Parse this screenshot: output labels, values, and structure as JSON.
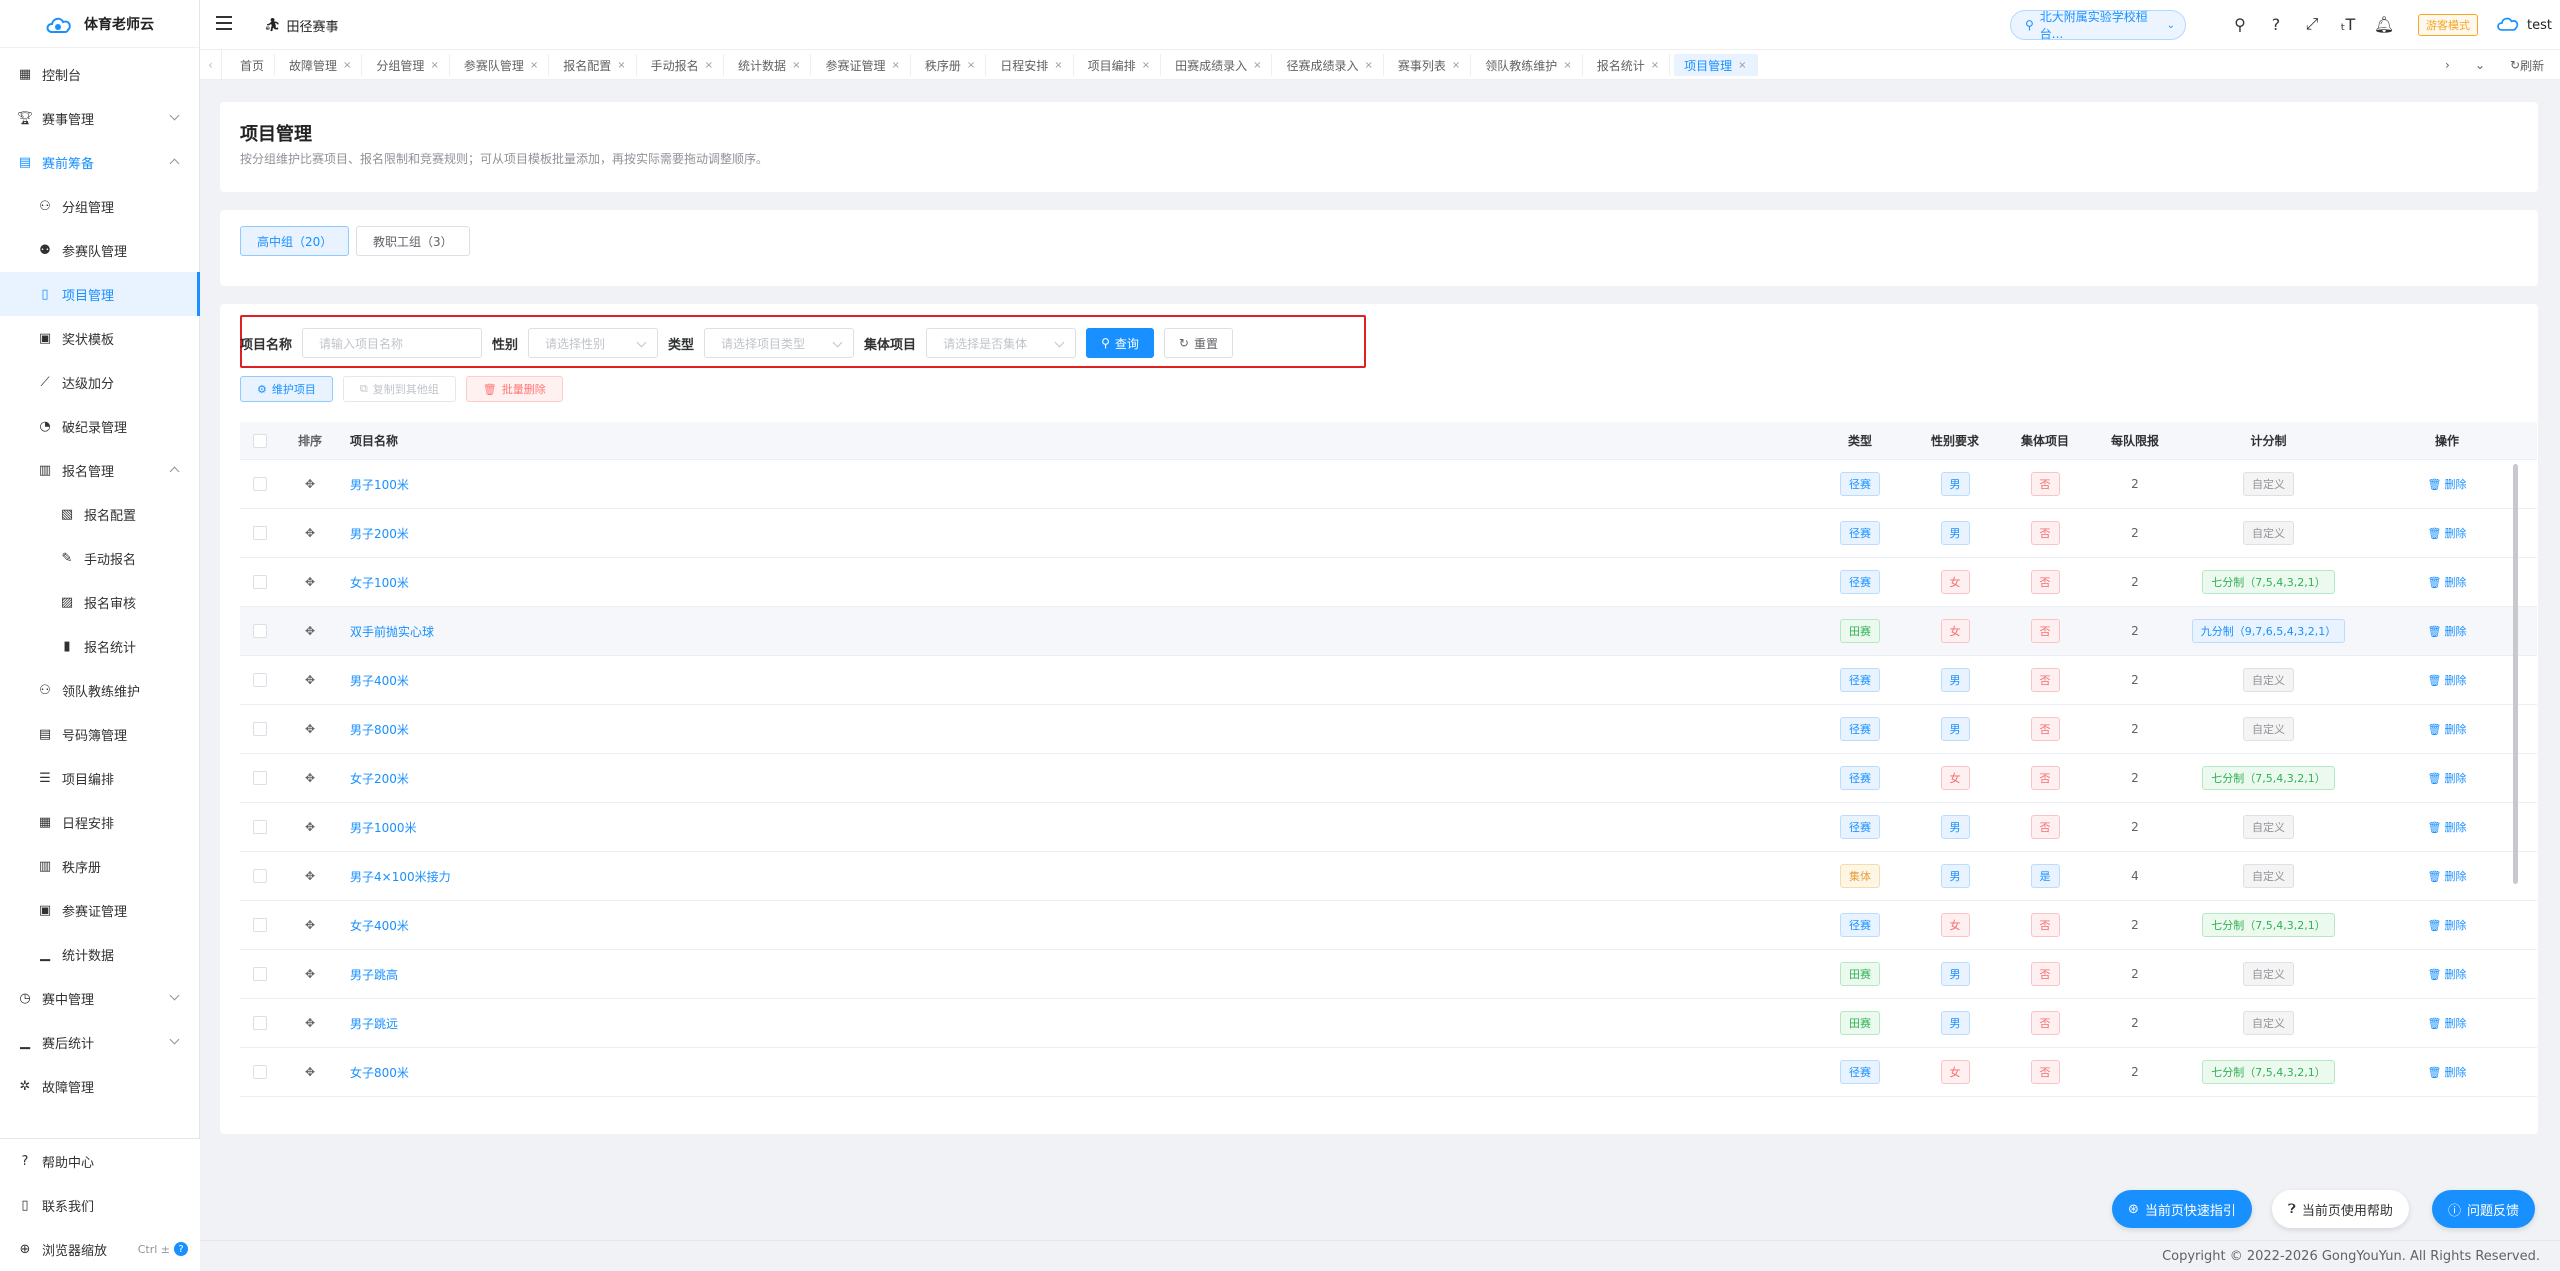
{
  "app": {
    "name": "体育老师云"
  },
  "header": {
    "title": "田径赛事",
    "school": "北大附属实验学校桓台...",
    "guest_mode": "游客模式",
    "user": "test"
  },
  "sidebar": {
    "items": [
      {
        "label": "控制台",
        "icon": "dashboard-icon"
      },
      {
        "label": "赛事管理",
        "icon": "trophy-icon"
      },
      {
        "label": "赛前筹备",
        "icon": "clipboard-icon"
      },
      {
        "label": "分组管理",
        "icon": "group-icon"
      },
      {
        "label": "参赛队管理",
        "icon": "team-icon"
      },
      {
        "label": "项目管理",
        "icon": "document-icon"
      },
      {
        "label": "奖状模板",
        "icon": "certificate-icon"
      },
      {
        "label": "达级加分",
        "icon": "level-icon"
      },
      {
        "label": "破纪录管理",
        "icon": "record-icon"
      },
      {
        "label": "报名管理",
        "icon": "signup-icon"
      },
      {
        "label": "报名配置",
        "icon": "config-icon"
      },
      {
        "label": "手动报名",
        "icon": "manual-icon"
      },
      {
        "label": "报名审核",
        "icon": "audit-icon"
      },
      {
        "label": "报名统计",
        "icon": "stats-icon"
      },
      {
        "label": "领队教练维护",
        "icon": "coach-icon"
      },
      {
        "label": "号码簿管理",
        "icon": "bib-icon"
      },
      {
        "label": "项目编排",
        "icon": "arrange-icon"
      },
      {
        "label": "日程安排",
        "icon": "calendar-icon"
      },
      {
        "label": "秩序册",
        "icon": "book-icon"
      },
      {
        "label": "参赛证管理",
        "icon": "badge-icon"
      },
      {
        "label": "统计数据",
        "icon": "chart-icon"
      },
      {
        "label": "赛中管理",
        "icon": "timer-icon"
      },
      {
        "label": "赛后统计",
        "icon": "bar-icon"
      },
      {
        "label": "故障管理",
        "icon": "bug-icon"
      }
    ],
    "bottom": {
      "help": "帮助中心",
      "contact": "联系我们",
      "zoom": "浏览器缩放",
      "zoom_hint": "Ctrl ±"
    }
  },
  "tabs": [
    "首页",
    "故障管理",
    "分组管理",
    "参赛队管理",
    "报名配置",
    "手动报名",
    "统计数据",
    "参赛证管理",
    "秩序册",
    "日程安排",
    "项目编排",
    "田赛成绩录入",
    "径赛成绩录入",
    "赛事列表",
    "领队教练维护",
    "报名统计",
    "项目管理"
  ],
  "tabs_refresh": "刷新",
  "page": {
    "title": "项目管理",
    "desc": "按分组维护比赛项目、报名限制和竞赛规则；可从项目模板批量添加，再按实际需要拖动调整顺序。",
    "groups": [
      "高中组（20）",
      "教职工组（3）"
    ]
  },
  "filter": {
    "name_label": "项目名称",
    "name_placeholder": "请输入项目名称",
    "sex_label": "性别",
    "sex_placeholder": "请选择性别",
    "type_label": "类型",
    "type_placeholder": "请选择项目类型",
    "team_label": "集体项目",
    "team_placeholder": "请选择是否集体",
    "query": "查询",
    "reset": "重置"
  },
  "actions": {
    "maintain": "维护项目",
    "copy": "复制到其他组",
    "batch_delete": "批量删除"
  },
  "table": {
    "headers": {
      "sort": "排序",
      "name": "项目名称",
      "type": "类型",
      "sex": "性别要求",
      "team": "集体项目",
      "max": "每队限报",
      "score": "计分制",
      "op": "操作"
    },
    "rows": [
      {
        "name": "男子100米",
        "type": "径赛",
        "sex": "男",
        "team": "否",
        "max": "2",
        "score": "自定义",
        "op": "删除"
      },
      {
        "name": "男子200米",
        "type": "径赛",
        "sex": "男",
        "team": "否",
        "max": "2",
        "score": "自定义",
        "op": "删除"
      },
      {
        "name": "女子100米",
        "type": "径赛",
        "sex": "女",
        "team": "否",
        "max": "2",
        "score": "七分制（7,5,4,3,2,1）",
        "op": "删除"
      },
      {
        "name": "双手前抛实心球",
        "type": "田赛",
        "sex": "女",
        "team": "否",
        "max": "2",
        "score": "九分制（9,7,6,5,4,3,2,1）",
        "op": "删除"
      },
      {
        "name": "男子400米",
        "type": "径赛",
        "sex": "男",
        "team": "否",
        "max": "2",
        "score": "自定义",
        "op": "删除"
      },
      {
        "name": "男子800米",
        "type": "径赛",
        "sex": "男",
        "team": "否",
        "max": "2",
        "score": "自定义",
        "op": "删除"
      },
      {
        "name": "女子200米",
        "type": "径赛",
        "sex": "女",
        "team": "否",
        "max": "2",
        "score": "七分制（7,5,4,3,2,1）",
        "op": "删除"
      },
      {
        "name": "男子1000米",
        "type": "径赛",
        "sex": "男",
        "team": "否",
        "max": "2",
        "score": "自定义",
        "op": "删除"
      },
      {
        "name": "男子4×100米接力",
        "type": "集体",
        "sex": "男",
        "team": "是",
        "max": "4",
        "score": "自定义",
        "op": "删除"
      },
      {
        "name": "女子400米",
        "type": "径赛",
        "sex": "女",
        "team": "否",
        "max": "2",
        "score": "七分制（7,5,4,3,2,1）",
        "op": "删除"
      },
      {
        "name": "男子跳高",
        "type": "田赛",
        "sex": "男",
        "team": "否",
        "max": "2",
        "score": "自定义",
        "op": "删除"
      },
      {
        "name": "男子跳远",
        "type": "田赛",
        "sex": "男",
        "team": "否",
        "max": "2",
        "score": "自定义",
        "op": "删除"
      },
      {
        "name": "女子800米",
        "type": "径赛",
        "sex": "女",
        "team": "否",
        "max": "2",
        "score": "七分制（7,5,4,3,2,1）",
        "op": "删除"
      }
    ]
  },
  "floating": {
    "guide": "当前页快速指引",
    "help": "当前页使用帮助",
    "feedback": "问题反馈"
  },
  "footer": "Copyright © 2022-2026 GongYouYun. All Rights Reserved."
}
